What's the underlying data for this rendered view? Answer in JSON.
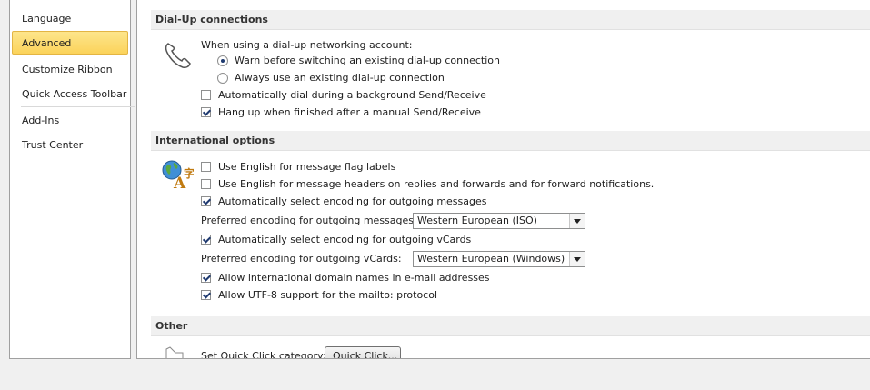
{
  "nav": {
    "items": [
      {
        "label": "Language",
        "selected": false
      },
      {
        "label": "Advanced",
        "selected": true
      },
      {
        "label": "Customize Ribbon",
        "selected": false
      },
      {
        "label": "Quick Access Toolbar",
        "selected": false
      },
      {
        "label": "Add-Ins",
        "selected": false
      },
      {
        "label": "Trust Center",
        "selected": false
      }
    ]
  },
  "dialup": {
    "header": "Dial-Up connections",
    "intro": "When using a dial-up networking account:",
    "radio_warn": "Warn before switching an existing dial-up connection",
    "radio_always": "Always use an existing dial-up connection",
    "auto_dial": "Automatically dial during a background Send/Receive",
    "hang_up": "Hang up when finished after a manual Send/Receive",
    "selected_radio": "warn",
    "auto_dial_checked": false,
    "hang_up_checked": true
  },
  "intl": {
    "header": "International options",
    "flag_labels": "Use English for message flag labels",
    "msg_headers": "Use English for message headers on replies and forwards and for forward notifications.",
    "auto_encoding_msg": "Automatically select encoding for outgoing messages",
    "pref_encoding_msg_label": "Preferred encoding for outgoing messages:",
    "pref_encoding_msg_value": "Western European (ISO)",
    "auto_encoding_vcards": "Automatically select encoding for outgoing vCards",
    "pref_encoding_vcards_label": "Preferred encoding for outgoing vCards:",
    "pref_encoding_vcards_value": "Western European (Windows)",
    "idn": "Allow international domain names in e-mail addresses",
    "utf8": "Allow UTF-8 support for the mailto: protocol"
  },
  "other": {
    "header": "Other",
    "quick_click_label": "Set Quick Click category:",
    "quick_click_button": "Quick Click..."
  },
  "colors": {
    "selected_nav": "#fbd35b",
    "check_mark": "#1f3a70"
  }
}
